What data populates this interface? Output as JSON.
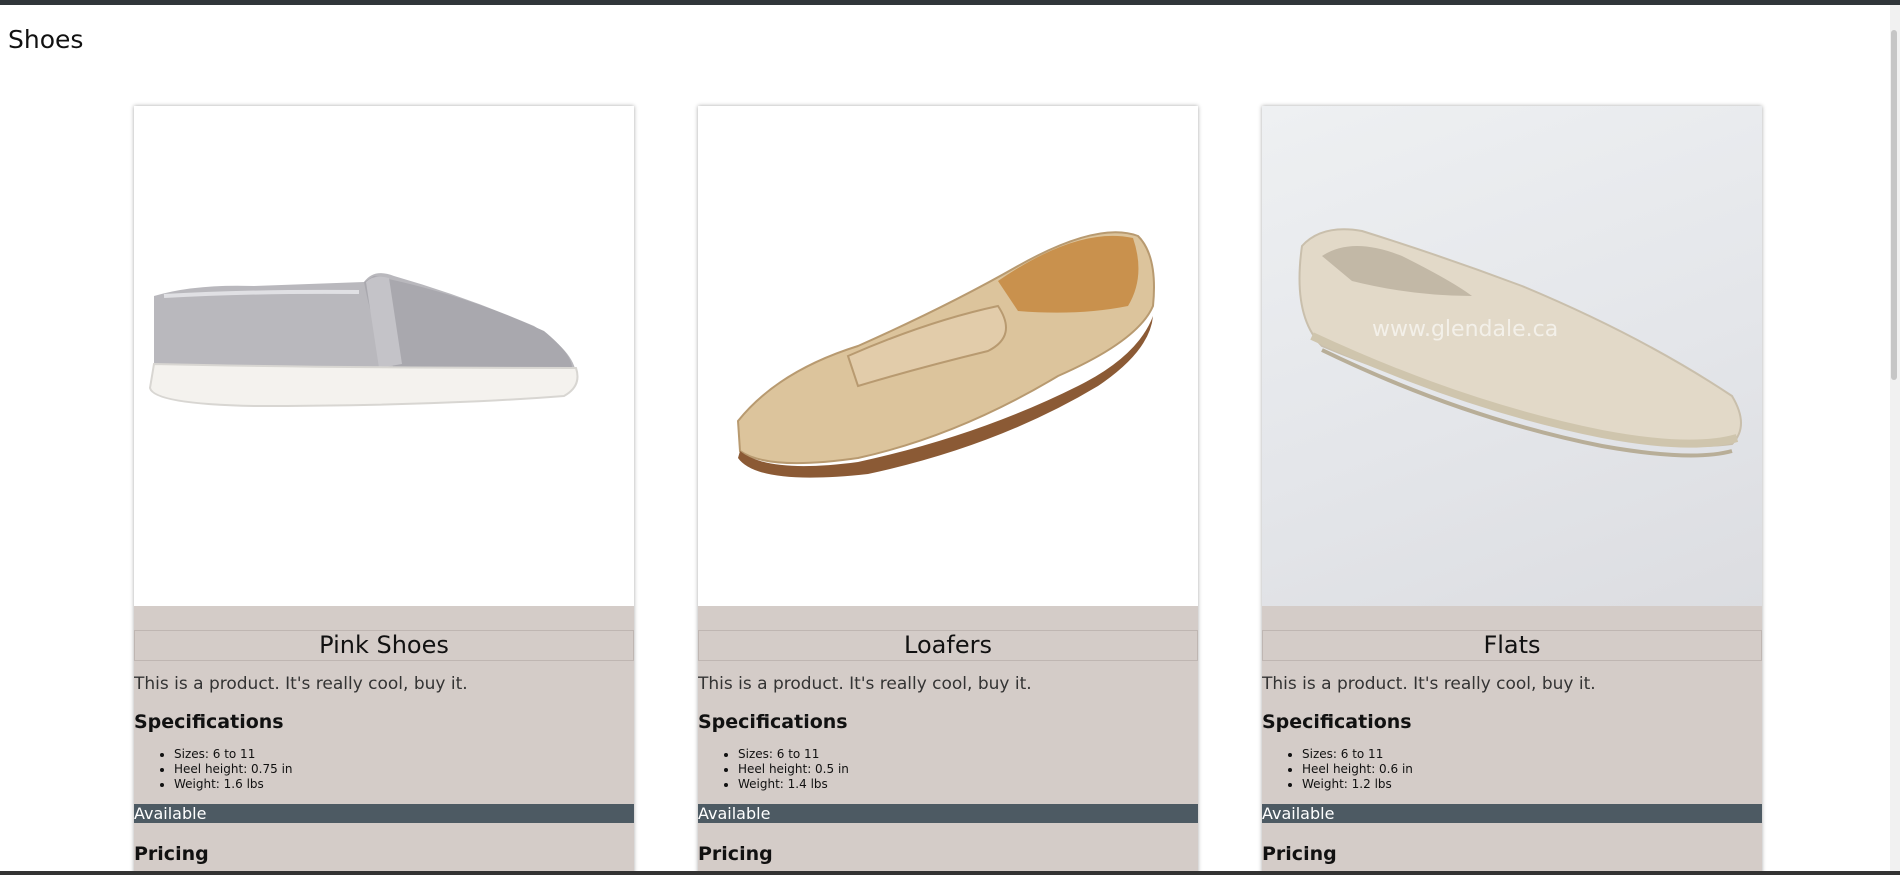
{
  "page": {
    "title": "Shoes"
  },
  "products": [
    {
      "name": "Pink Shoes",
      "image_icon": "grey-slip-on-sneaker-image",
      "description": "This is a product. It's really cool, buy it.",
      "specs_heading": "Specifications",
      "specs": [
        "Sizes: 6 to 11",
        "Heel height: 0.75 in",
        "Weight: 1.6 lbs"
      ],
      "availability": "Available",
      "pricing_heading": "Pricing"
    },
    {
      "name": "Loafers",
      "image_icon": "beige-penny-loafer-image",
      "description": "This is a product. It's really cool, buy it.",
      "specs_heading": "Specifications",
      "specs": [
        "Sizes: 6 to 11",
        "Heel height: 0.5 in",
        "Weight: 1.4 lbs"
      ],
      "availability": "Available",
      "pricing_heading": "Pricing"
    },
    {
      "name": "Flats",
      "image_icon": "canvas-flat-shoe-image",
      "image_watermark": "www.glendale.ca",
      "description": "This is a product. It's really cool, buy it.",
      "specs_heading": "Specifications",
      "specs": [
        "Sizes: 6 to 11",
        "Heel height: 0.6 in",
        "Weight: 1.2 lbs"
      ],
      "availability": "Available",
      "pricing_heading": "Pricing"
    }
  ],
  "colors": {
    "card_background": "#d4ccc8",
    "availability_bar": "#4d5a63",
    "top_bar": "#30363a"
  }
}
